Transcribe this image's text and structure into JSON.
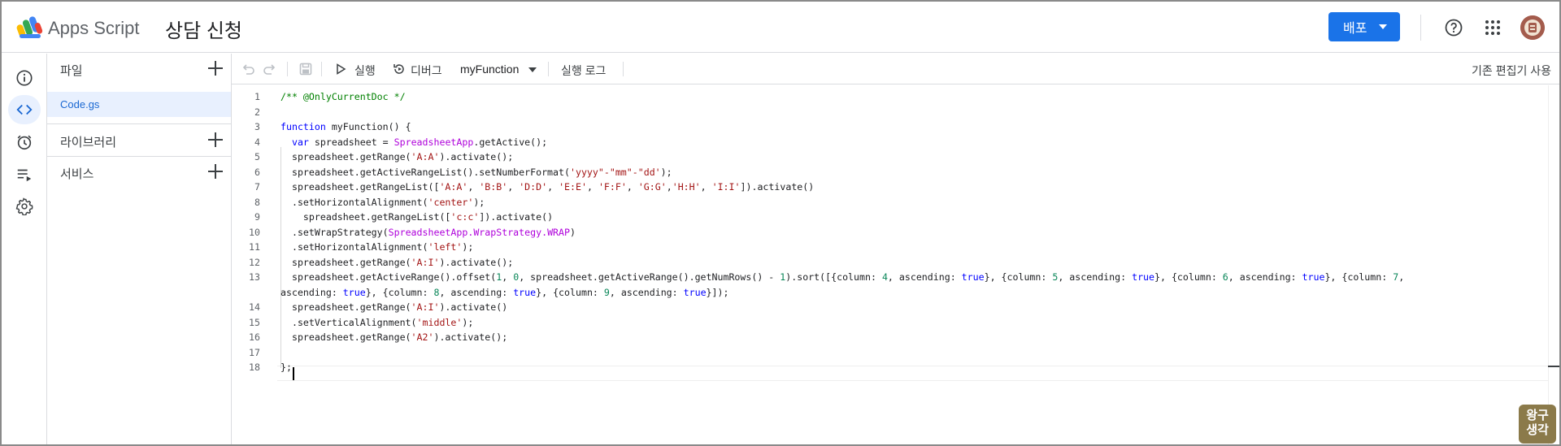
{
  "app": {
    "brand": "Apps Script",
    "project_title": "상담 신청"
  },
  "header": {
    "deploy_label": "배포",
    "help_icon": "help-icon",
    "apps_icon": "apps-grid-icon",
    "avatar_icon": "avatar-icon"
  },
  "rail": {
    "items": [
      {
        "name": "overview",
        "icon": "info-icon",
        "active": false
      },
      {
        "name": "editor",
        "icon": "code-icon",
        "active": true
      },
      {
        "name": "triggers",
        "icon": "alarm-icon",
        "active": false
      },
      {
        "name": "executions",
        "icon": "executions-icon",
        "active": false
      },
      {
        "name": "settings",
        "icon": "gear-icon",
        "active": false
      }
    ]
  },
  "files": {
    "files_label": "파일",
    "file_name": "Code.gs",
    "libraries_label": "라이브러리",
    "services_label": "서비스"
  },
  "toolbar": {
    "run_label": "실행",
    "debug_label": "디버그",
    "function_name": "myFunction",
    "log_label": "실행 로그",
    "legacy_label": "기존 편집기 사용"
  },
  "editor": {
    "line_numbers": [
      "1",
      "2",
      "3",
      "4",
      "5",
      "6",
      "7",
      "8",
      "9",
      "10",
      "11",
      "12",
      "13",
      "",
      "14",
      "15",
      "16",
      "17",
      "18"
    ],
    "lines": [
      "/** @OnlyCurrentDoc */",
      "",
      "function myFunction() {",
      "  var spreadsheet = SpreadsheetApp.getActive();",
      "  spreadsheet.getRange('A:A').activate();",
      "  spreadsheet.getActiveRangeList().setNumberFormat('yyyy\"-\"mm\"-\"dd');",
      "  spreadsheet.getRangeList(['A:A', 'B:B', 'D:D', 'E:E', 'F:F', 'G:G','H:H', 'I:I']).activate()",
      "  .setHorizontalAlignment('center');",
      "    spreadsheet.getRangeList(['c:c']).activate()",
      "  .setWrapStrategy(SpreadsheetApp.WrapStrategy.WRAP)",
      "  .setHorizontalAlignment('left');",
      "  spreadsheet.getRange('A:I').activate();",
      "  spreadsheet.getActiveRange().offset(1, 0, spreadsheet.getActiveRange().getNumRows() - 1).sort([{column: 4, ascending: true}, {column: 5, ascending: true}, {column: 6, ascending: true}, {column: 7,",
      "ascending: true}, {column: 8, ascending: true}, {column: 9, ascending: true}]);",
      "  spreadsheet.getRange('A:I').activate()",
      "  .setVerticalAlignment('middle');",
      "  spreadsheet.getRange('A2').activate();",
      "",
      "};"
    ]
  },
  "watermark": {
    "line1": "왕구",
    "line2": "생각"
  },
  "colors": {
    "accent": "#1a73e8",
    "keyword": "#0000ff",
    "string": "#a31515",
    "comment": "#008000",
    "class": "#af00db",
    "number": "#098658"
  }
}
